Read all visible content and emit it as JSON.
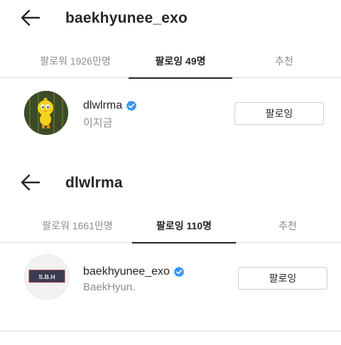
{
  "colors": {
    "text": "#262626",
    "secondary_text": "#8e8e8e",
    "divider": "#dbdbdb",
    "verified_badge": "#3897f0",
    "active_tab_indicator": "#262626"
  },
  "panels": [
    {
      "header": {
        "back_icon": "arrow-left-icon",
        "title": "baekhyunee_exo"
      },
      "tabs": [
        {
          "label": "팔로워 1926만명",
          "active": false
        },
        {
          "label": "팔로잉 49명",
          "active": true
        },
        {
          "label": "추천",
          "active": false
        }
      ],
      "partial_tab_glyph": "",
      "users": [
        {
          "username": "dlwlrma",
          "verified": true,
          "display_name": "이지금",
          "button_label": "팔로잉",
          "avatar": "tweety-bird-avatar"
        }
      ]
    },
    {
      "header": {
        "back_icon": "arrow-left-icon",
        "title": "dlwlrma"
      },
      "tabs": [
        {
          "label": "팔로워 1661만명",
          "active": false
        },
        {
          "label": "팔로잉 110명",
          "active": true
        },
        {
          "label": "추천",
          "active": false
        }
      ],
      "partial_tab_glyph": "",
      "users": [
        {
          "username": "baekhyunee_exo",
          "verified": true,
          "display_name": "BaekHyun.",
          "button_label": "팔로잉",
          "avatar": "sbh-logo-avatar",
          "avatar_text": "S.B.H"
        }
      ]
    }
  ]
}
